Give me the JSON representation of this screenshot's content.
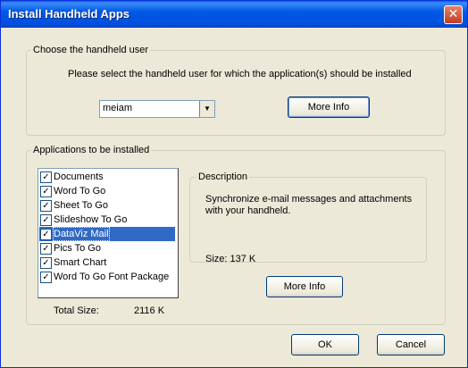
{
  "window": {
    "title": "Install Handheld Apps",
    "close_glyph": "✕"
  },
  "user_group": {
    "legend": "Choose the handheld user",
    "prompt": "Please select the handheld user for which the application(s) should be installed",
    "selected_user": "meiam",
    "more_info_label": "More Info"
  },
  "apps_group": {
    "legend": "Applications to be installed",
    "items": [
      {
        "label": "Documents",
        "checked": true,
        "selected": false
      },
      {
        "label": "Word To Go",
        "checked": true,
        "selected": false
      },
      {
        "label": "Sheet To Go",
        "checked": true,
        "selected": false
      },
      {
        "label": "Slideshow To Go",
        "checked": true,
        "selected": false
      },
      {
        "label": "DataViz Mail",
        "checked": true,
        "selected": true
      },
      {
        "label": "Pics To Go",
        "checked": true,
        "selected": false
      },
      {
        "label": "Smart Chart",
        "checked": true,
        "selected": false
      },
      {
        "label": "Word To Go Font Package",
        "checked": true,
        "selected": false
      }
    ],
    "total_size_label": "Total Size:",
    "total_size_value": "2116 K",
    "description": {
      "legend": "Description",
      "text": "Synchronize e-mail messages and attachments with your handheld.",
      "size": "Size: 137 K"
    },
    "more_info_label": "More Info"
  },
  "buttons": {
    "ok": "OK",
    "cancel": "Cancel"
  },
  "colors": {
    "selection": "#316ac5",
    "titlebar": "#0058e6",
    "dialog_bg": "#ece9d8"
  }
}
